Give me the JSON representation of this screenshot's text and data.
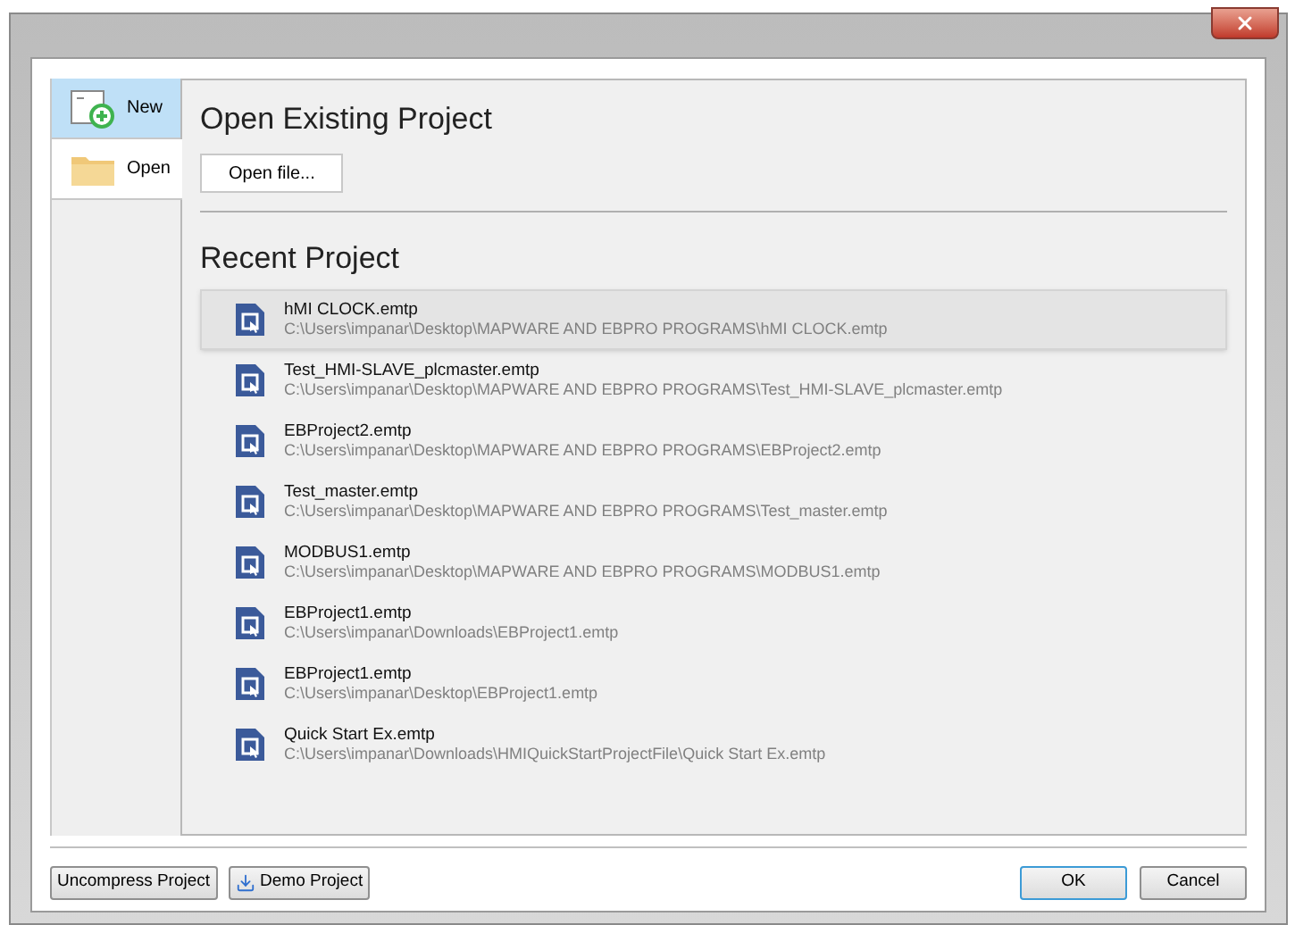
{
  "tabs": [
    {
      "label": "New",
      "kind": "new",
      "selected": false,
      "highlighted": true
    },
    {
      "label": "Open",
      "kind": "open",
      "selected": true,
      "highlighted": false
    }
  ],
  "open_section": {
    "title": "Open Existing Project",
    "button": "Open file..."
  },
  "recent": {
    "title": "Recent Project",
    "items": [
      {
        "name": "hMI CLOCK.emtp",
        "path": "C:\\Users\\impanar\\Desktop\\MAPWARE AND EBPRO PROGRAMS\\hMI CLOCK.emtp",
        "selected": true
      },
      {
        "name": "Test_HMI-SLAVE_plcmaster.emtp",
        "path": "C:\\Users\\impanar\\Desktop\\MAPWARE AND EBPRO PROGRAMS\\Test_HMI-SLAVE_plcmaster.emtp",
        "selected": false
      },
      {
        "name": "EBProject2.emtp",
        "path": "C:\\Users\\impanar\\Desktop\\MAPWARE AND EBPRO PROGRAMS\\EBProject2.emtp",
        "selected": false
      },
      {
        "name": "Test_master.emtp",
        "path": "C:\\Users\\impanar\\Desktop\\MAPWARE AND EBPRO PROGRAMS\\Test_master.emtp",
        "selected": false
      },
      {
        "name": "MODBUS1.emtp",
        "path": "C:\\Users\\impanar\\Desktop\\MAPWARE AND EBPRO PROGRAMS\\MODBUS1.emtp",
        "selected": false
      },
      {
        "name": "EBProject1.emtp",
        "path": "C:\\Users\\impanar\\Downloads\\EBProject1.emtp",
        "selected": false
      },
      {
        "name": "EBProject1.emtp",
        "path": "C:\\Users\\impanar\\Desktop\\EBProject1.emtp",
        "selected": false
      },
      {
        "name": "Quick Start Ex.emtp",
        "path": "C:\\Users\\impanar\\Downloads\\HMIQuickStartProjectFile\\Quick Start Ex.emtp",
        "selected": false
      }
    ]
  },
  "footer": {
    "left_buttons": [
      {
        "label": "Uncompress Project",
        "kind": "plain"
      },
      {
        "label": "Demo Project",
        "kind": "download"
      }
    ],
    "right_buttons": [
      {
        "label": "OK",
        "kind": "default"
      },
      {
        "label": "Cancel",
        "kind": "plain"
      }
    ]
  }
}
